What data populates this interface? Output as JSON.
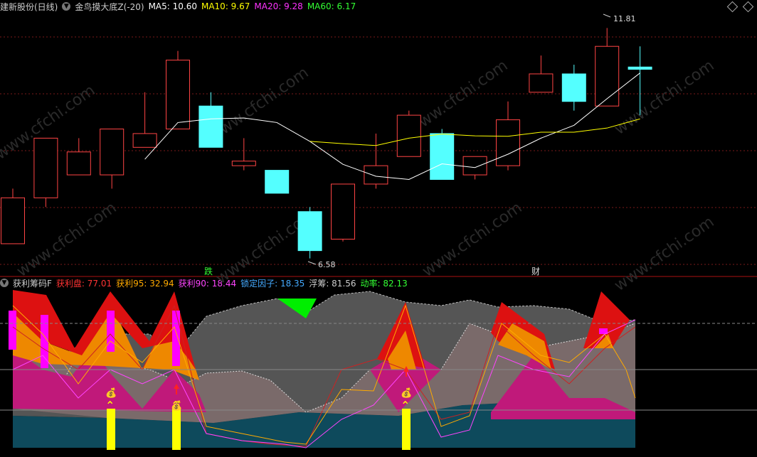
{
  "top_header": {
    "title": "建新股份(日线)",
    "indicator": "金鸟摸大底Z(-20)",
    "ma": [
      {
        "label": "MA5: 10.60",
        "color": "#ffffff"
      },
      {
        "label": "MA10: 9.67",
        "color": "#ffff00"
      },
      {
        "label": "MA20: 9.28",
        "color": "#ff00ff"
      },
      {
        "label": "MA60: 6.17",
        "color": "#00ff00"
      }
    ]
  },
  "bottom_header": {
    "items": [
      {
        "label": "获利筹码F",
        "color": "#cccccc"
      },
      {
        "label": "获利盘: 77.01",
        "color": "#ff3333"
      },
      {
        "label": "获利95: 32.94",
        "color": "#ffaa00"
      },
      {
        "label": "获利90: 18.44",
        "color": "#ff44ff"
      },
      {
        "label": "锁定因子: 18.35",
        "color": "#44aaff"
      },
      {
        "label": "浮筹: 81.56",
        "color": "#cccccc"
      },
      {
        "label": "动率: 82.13",
        "color": "#00ff00"
      }
    ]
  },
  "price_labels": {
    "high": "11.81",
    "low": "6.58"
  },
  "tags": {
    "die": "跌",
    "cai": "财"
  },
  "watermark": "www.cfchi.com",
  "colors": {
    "up": "#ff4444",
    "down": "#54ffff",
    "ma5": "#ffffff",
    "ma10": "#ffff00",
    "ma20": "#ff00ff"
  },
  "chart_data": {
    "type": "candlestick",
    "series": [
      {
        "open": 6.9,
        "close": 7.9,
        "high": 8.1,
        "low": 6.9
      },
      {
        "open": 7.9,
        "close": 9.2,
        "high": 9.2,
        "low": 7.7
      },
      {
        "open": 8.4,
        "close": 8.9,
        "high": 9.2,
        "low": 8.4
      },
      {
        "open": 8.4,
        "close": 9.4,
        "high": 9.4,
        "low": 8.1
      },
      {
        "open": 9.0,
        "close": 9.3,
        "high": 10.2,
        "low": 9.0
      },
      {
        "open": 9.4,
        "close": 10.9,
        "high": 11.1,
        "low": 9.4
      },
      {
        "open": 9.9,
        "close": 9.0,
        "high": 10.2,
        "low": 9.0
      },
      {
        "open": 8.6,
        "close": 8.7,
        "high": 9.2,
        "low": 8.5
      },
      {
        "open": 8.5,
        "close": 8.0,
        "high": 8.5,
        "low": 8.0
      },
      {
        "open": 7.6,
        "close": 6.75,
        "high": 7.7,
        "low": 6.58
      },
      {
        "open": 7.0,
        "close": 8.2,
        "high": 8.2,
        "low": 6.95
      },
      {
        "open": 8.2,
        "close": 8.6,
        "high": 9.3,
        "low": 8.1
      },
      {
        "open": 8.8,
        "close": 9.7,
        "high": 9.8,
        "low": 8.8
      },
      {
        "open": 9.3,
        "close": 8.3,
        "high": 9.4,
        "low": 8.3
      },
      {
        "open": 8.4,
        "close": 8.8,
        "high": 8.8,
        "low": 8.3
      },
      {
        "open": 8.6,
        "close": 9.6,
        "high": 10.0,
        "low": 8.5
      },
      {
        "open": 10.2,
        "close": 10.6,
        "high": 11.0,
        "low": 10.2
      },
      {
        "open": 10.6,
        "close": 10.0,
        "high": 10.8,
        "low": 9.8
      },
      {
        "open": 9.9,
        "close": 11.2,
        "high": 11.6,
        "low": 9.9
      },
      {
        "open": 10.75,
        "close": 10.7,
        "high": 11.2,
        "low": 9.7
      }
    ],
    "ma5": [
      null,
      null,
      null,
      null,
      8.74,
      9.54,
      9.62,
      9.64,
      9.54,
      9.13,
      8.63,
      8.37,
      8.3,
      8.64,
      8.56,
      8.85,
      9.2,
      9.48,
      10.06,
      10.62
    ],
    "ma10": [
      null,
      null,
      null,
      null,
      null,
      null,
      null,
      null,
      null,
      9.13,
      9.08,
      9.04,
      9.2,
      9.29,
      9.25,
      9.24,
      9.33,
      9.33,
      9.42,
      9.62
    ],
    "ma20": [
      null,
      null,
      null,
      null,
      null,
      null,
      null,
      null,
      null,
      null,
      null,
      null,
      null,
      null,
      null,
      null,
      null,
      null,
      null,
      9.28
    ],
    "ylim": [
      6.45,
      11.9
    ]
  }
}
